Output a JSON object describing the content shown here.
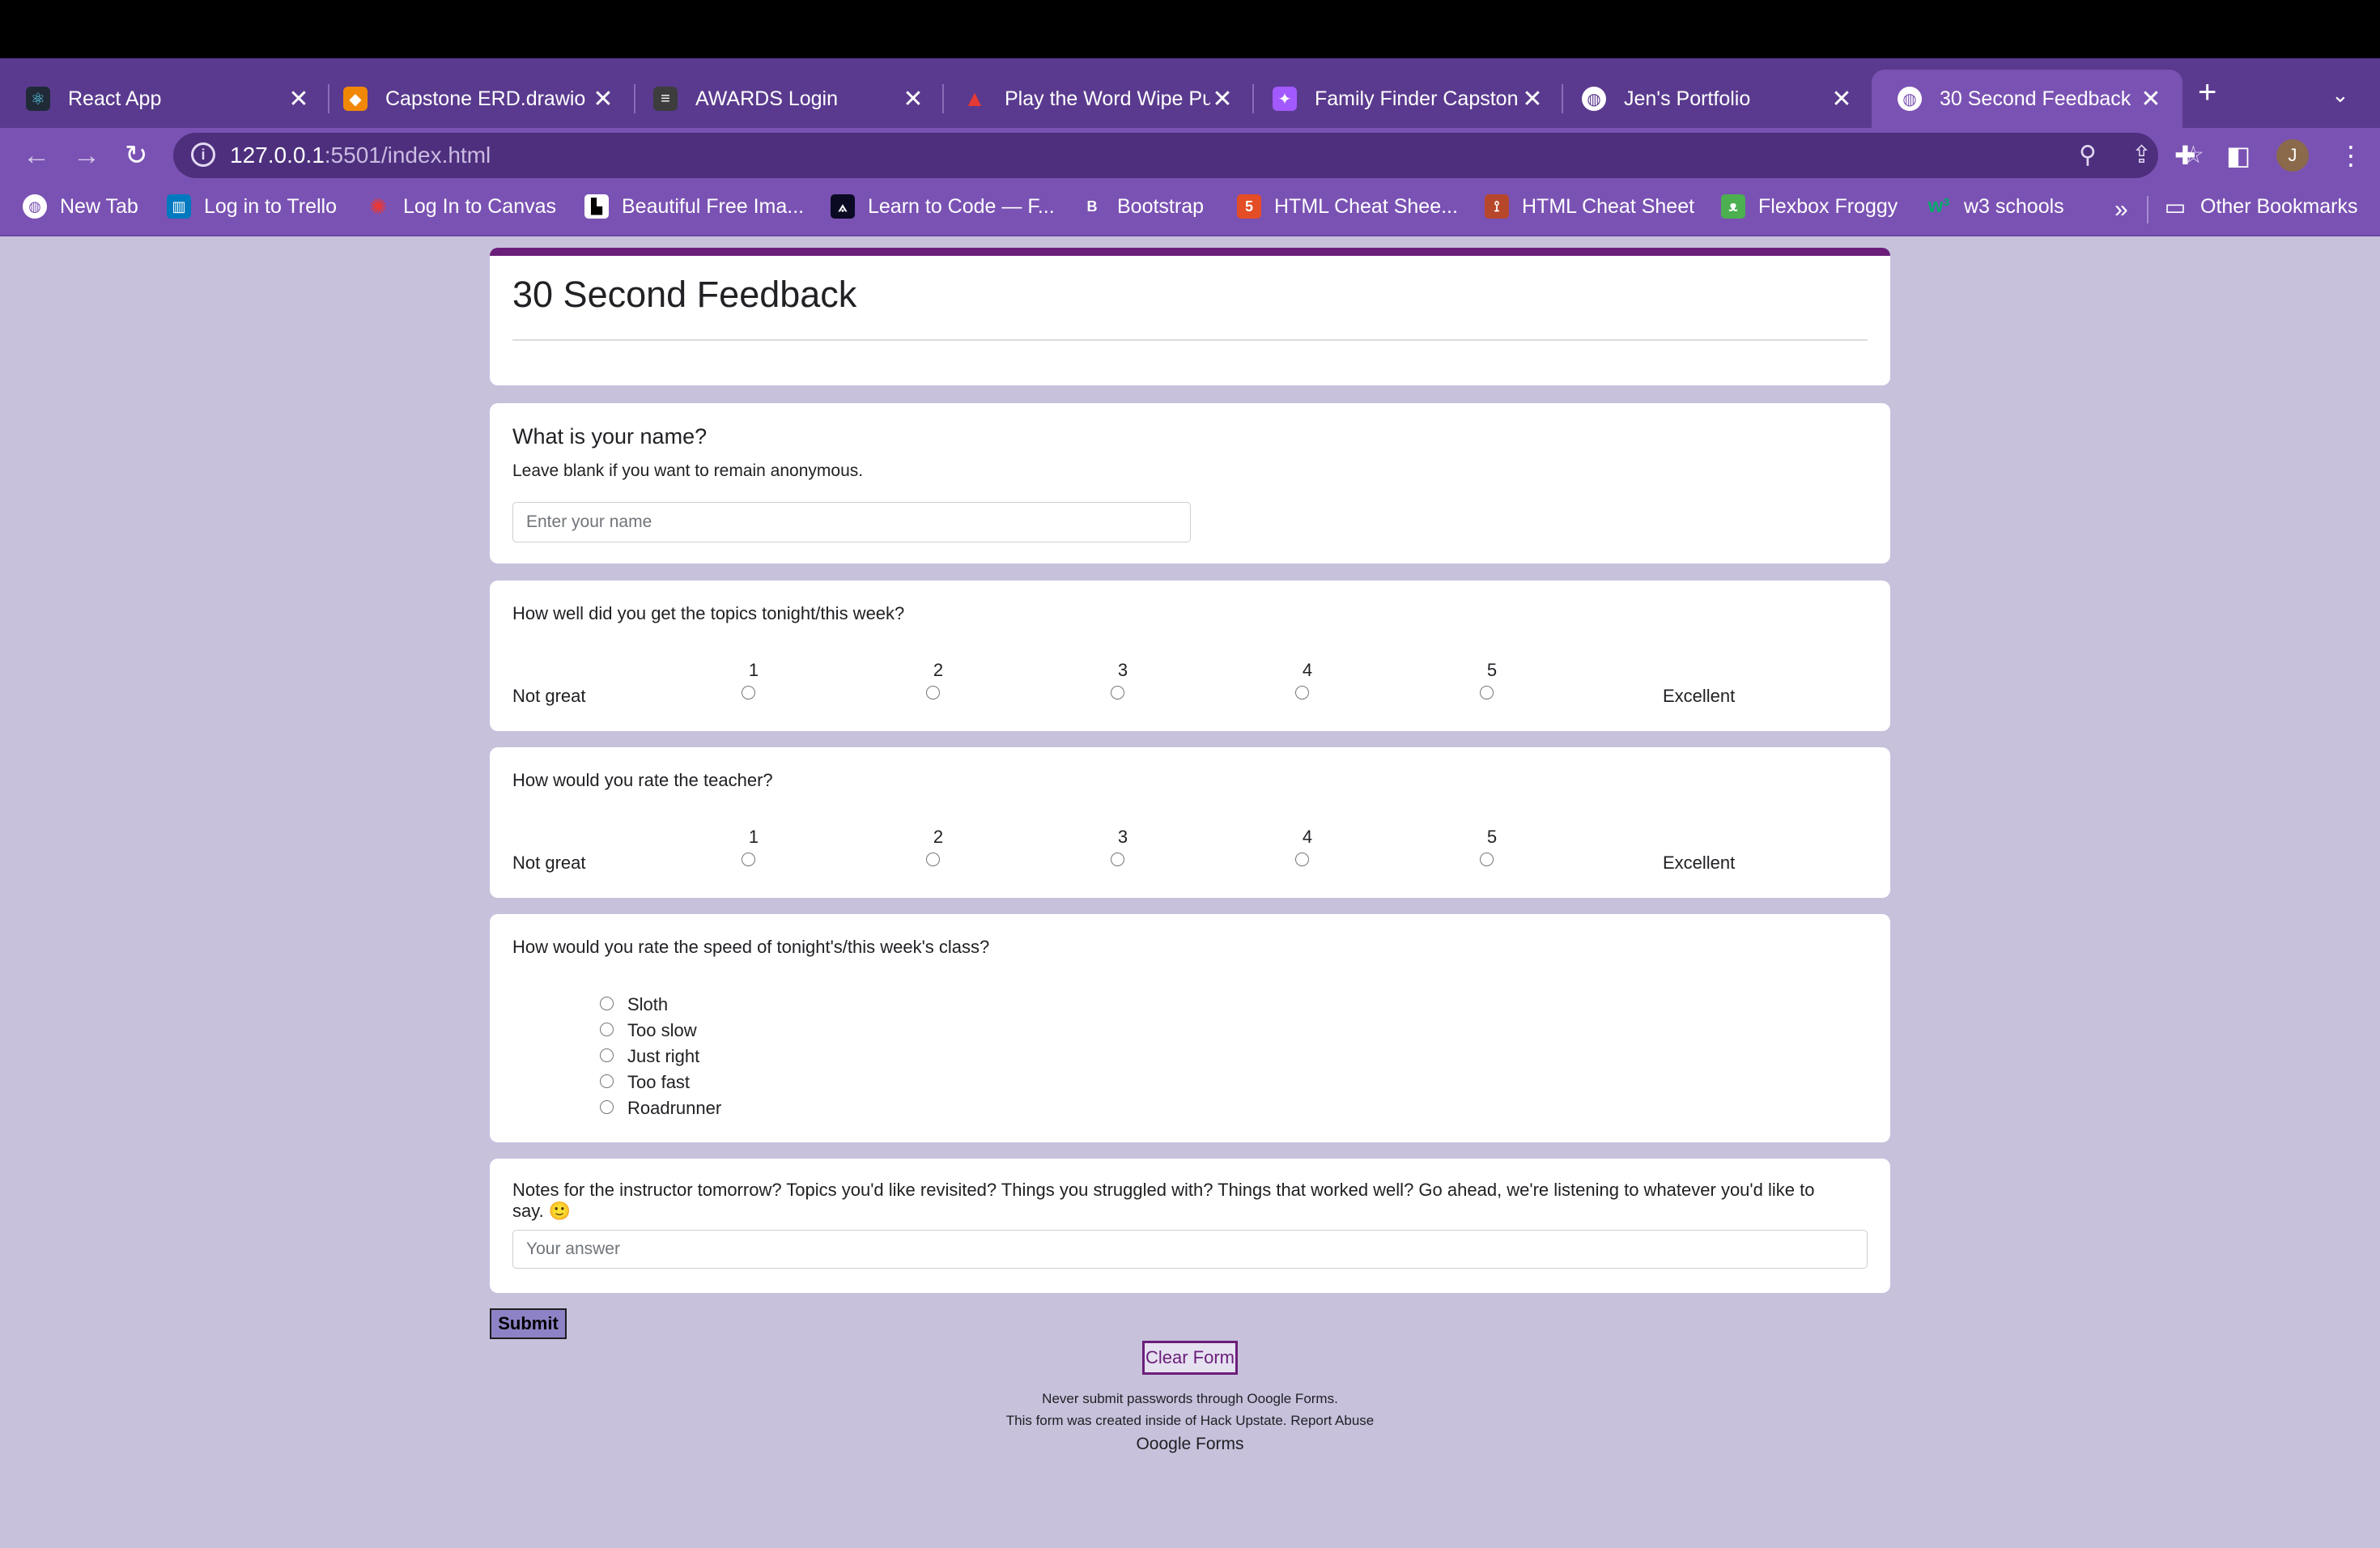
{
  "browser": {
    "tabs": [
      {
        "title": "React App",
        "icon": "react-icon",
        "color": "#1f2a36"
      },
      {
        "title": "Capstone ERD.drawio",
        "icon": "drawio-icon",
        "color": "#f08705"
      },
      {
        "title": "AWARDS Login",
        "icon": "stack-icon",
        "color": "#3d3d3d"
      },
      {
        "title": "Play the Word Wipe Pu",
        "icon": "play-icon",
        "color": "#e53935"
      },
      {
        "title": "Family Finder Capston",
        "icon": "figma-icon",
        "color": "#a259ff"
      },
      {
        "title": "Jen's Portfolio",
        "icon": "globe-icon",
        "color": "#5a3a8e"
      },
      {
        "title": "30 Second Feedback",
        "icon": "globe-icon",
        "color": "#7a52b3"
      }
    ],
    "close_glyph": "✕",
    "new_tab_glyph": "+",
    "tab_menu_glyph": "⌄",
    "url_host": "127.0.0.1",
    "url_rest": ":5501/index.html",
    "avatar_letter": "J",
    "bookmarks": [
      {
        "label": "New Tab",
        "icon": "globe-icon"
      },
      {
        "label": "Log in to Trello",
        "icon": "trello-icon"
      },
      {
        "label": "Log In to Canvas",
        "icon": "canvas-icon"
      },
      {
        "label": "Beautiful Free Ima...",
        "icon": "unsplash-icon"
      },
      {
        "label": "Learn to Code — F...",
        "icon": "freecodecamp-icon"
      },
      {
        "label": "Bootstrap",
        "icon": "bootstrap-icon"
      },
      {
        "label": "HTML Cheat Shee...",
        "icon": "html5-icon"
      },
      {
        "label": "HTML Cheat Sheet",
        "icon": "html-icon"
      },
      {
        "label": "Flexbox Froggy",
        "icon": "frog-icon"
      },
      {
        "label": "w3 schools",
        "icon": "w3schools-icon"
      }
    ],
    "more_bookmarks_glyph": "»",
    "other_bookmarks": "Other Bookmarks"
  },
  "form": {
    "title": "30 Second Feedback",
    "name_question": {
      "title": "What is your name?",
      "subtitle": "Leave blank if you want to remain anonymous.",
      "placeholder": "Enter your name"
    },
    "topics_question": {
      "title": "How well did you get the topics tonight/this week?",
      "low_label": "Not great",
      "high_label": "Excellent",
      "scale": [
        "1",
        "2",
        "3",
        "4",
        "5"
      ]
    },
    "teacher_question": {
      "title": "How would you rate the teacher?",
      "low_label": "Not great",
      "high_label": "Excellent",
      "scale": [
        "1",
        "2",
        "3",
        "4",
        "5"
      ]
    },
    "speed_question": {
      "title": "How would you rate the speed of tonight's/this week's class?",
      "options": [
        "Sloth",
        "Too slow",
        "Just right",
        "Too fast",
        "Roadrunner"
      ]
    },
    "notes_question": {
      "title_line1": "Notes for the instructor tomorrow? Topics you'd like revisited? Things you struggled with? Things that worked well? Go ahead, we're listening to whatever you'd like to",
      "title_line2": "say. 🙂",
      "placeholder": "Your answer"
    },
    "submit_label": "Submit",
    "clear_label": "Clear Form",
    "footer_line1": "Never submit passwords through Ooogle Forms.",
    "footer_line2": "This form was created inside of Hack Upstate. Report Abuse",
    "footer_brand": "Ooogle Forms",
    "accent_color": "#6b1e7a",
    "page_background": "#c7c1dc"
  }
}
